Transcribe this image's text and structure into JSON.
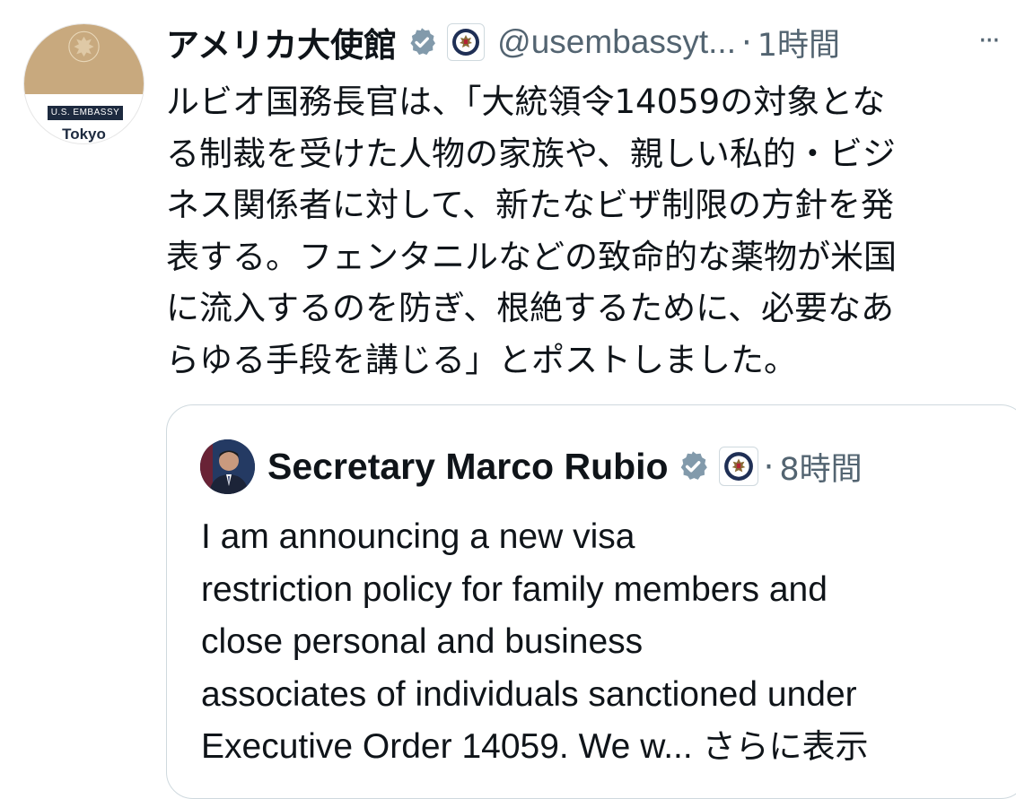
{
  "author": {
    "name": "アメリカ大使館",
    "handle": "@usembassyt...",
    "time": "1時間",
    "avatar_band": "U.S. EMBASSY",
    "avatar_city": "Tokyo",
    "verified_icon": "verified-badge-icon",
    "affiliate_icon": "state-department-seal-icon"
  },
  "more_label": "···",
  "separator": "·",
  "body_lines": [
    "ルビオ国務長官は、「大統領令14059の対象とな",
    "る制裁を受けた人物の家族や、親しい私的・ビジ",
    "ネス関係者に対して、新たなビザ制限の方針を発",
    "表する。フェンタニルなどの致命的な薬物が米国",
    "に流入するのを防ぎ、根絶するために、必要なあ",
    "らゆる手段を講じる」とポストしました。"
  ],
  "quoted": {
    "name": "Secretary Marco Rubio",
    "time": "8時間",
    "text_lines": [
      "I am announcing a new visa",
      "restriction policy for family members and",
      "close personal and business",
      "associates of individuals sanctioned under",
      "Executive Order 14059. We w..."
    ],
    "show_more": "さらに表示"
  },
  "colors": {
    "text": "#0f1419",
    "secondary": "#536471",
    "verified": "#829aab",
    "border": "#cfd9de",
    "avatar_gold": "#c8a97e",
    "avatar_navy": "#1d2a3f"
  }
}
